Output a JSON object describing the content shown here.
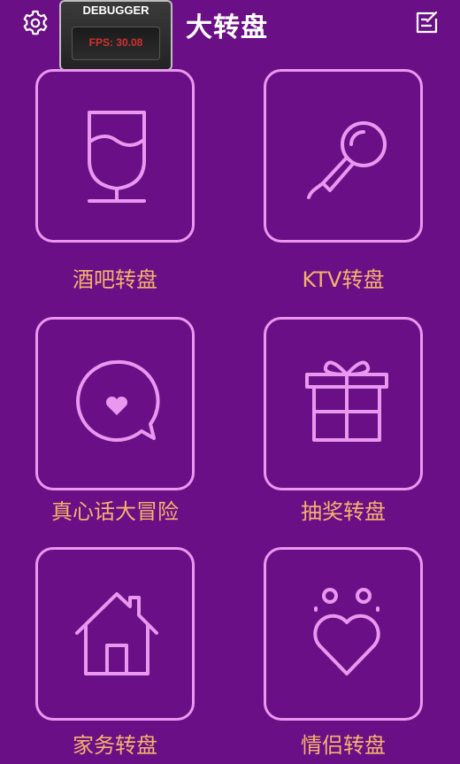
{
  "header": {
    "title": "大转盘",
    "settings_icon": "gear-icon",
    "edit_icon": "edit-icon"
  },
  "debugger": {
    "title": "DEBUGGER",
    "fps": "FPS: 30.08"
  },
  "tiles": [
    {
      "label": "酒吧转盘",
      "icon": "wine-glass-icon"
    },
    {
      "label": "KTV转盘",
      "icon": "microphone-icon"
    },
    {
      "label": "真心话大冒险",
      "icon": "speech-bubble-heart-icon"
    },
    {
      "label": "抽奖转盘",
      "icon": "gift-icon"
    },
    {
      "label": "家务转盘",
      "icon": "house-icon"
    },
    {
      "label": "情侣转盘",
      "icon": "couple-heart-icon"
    }
  ],
  "colors": {
    "background": "#6a0f86",
    "icon_stroke": "#ea97f0",
    "label_text": "#f5b26e",
    "fps_text": "#d1302f"
  }
}
